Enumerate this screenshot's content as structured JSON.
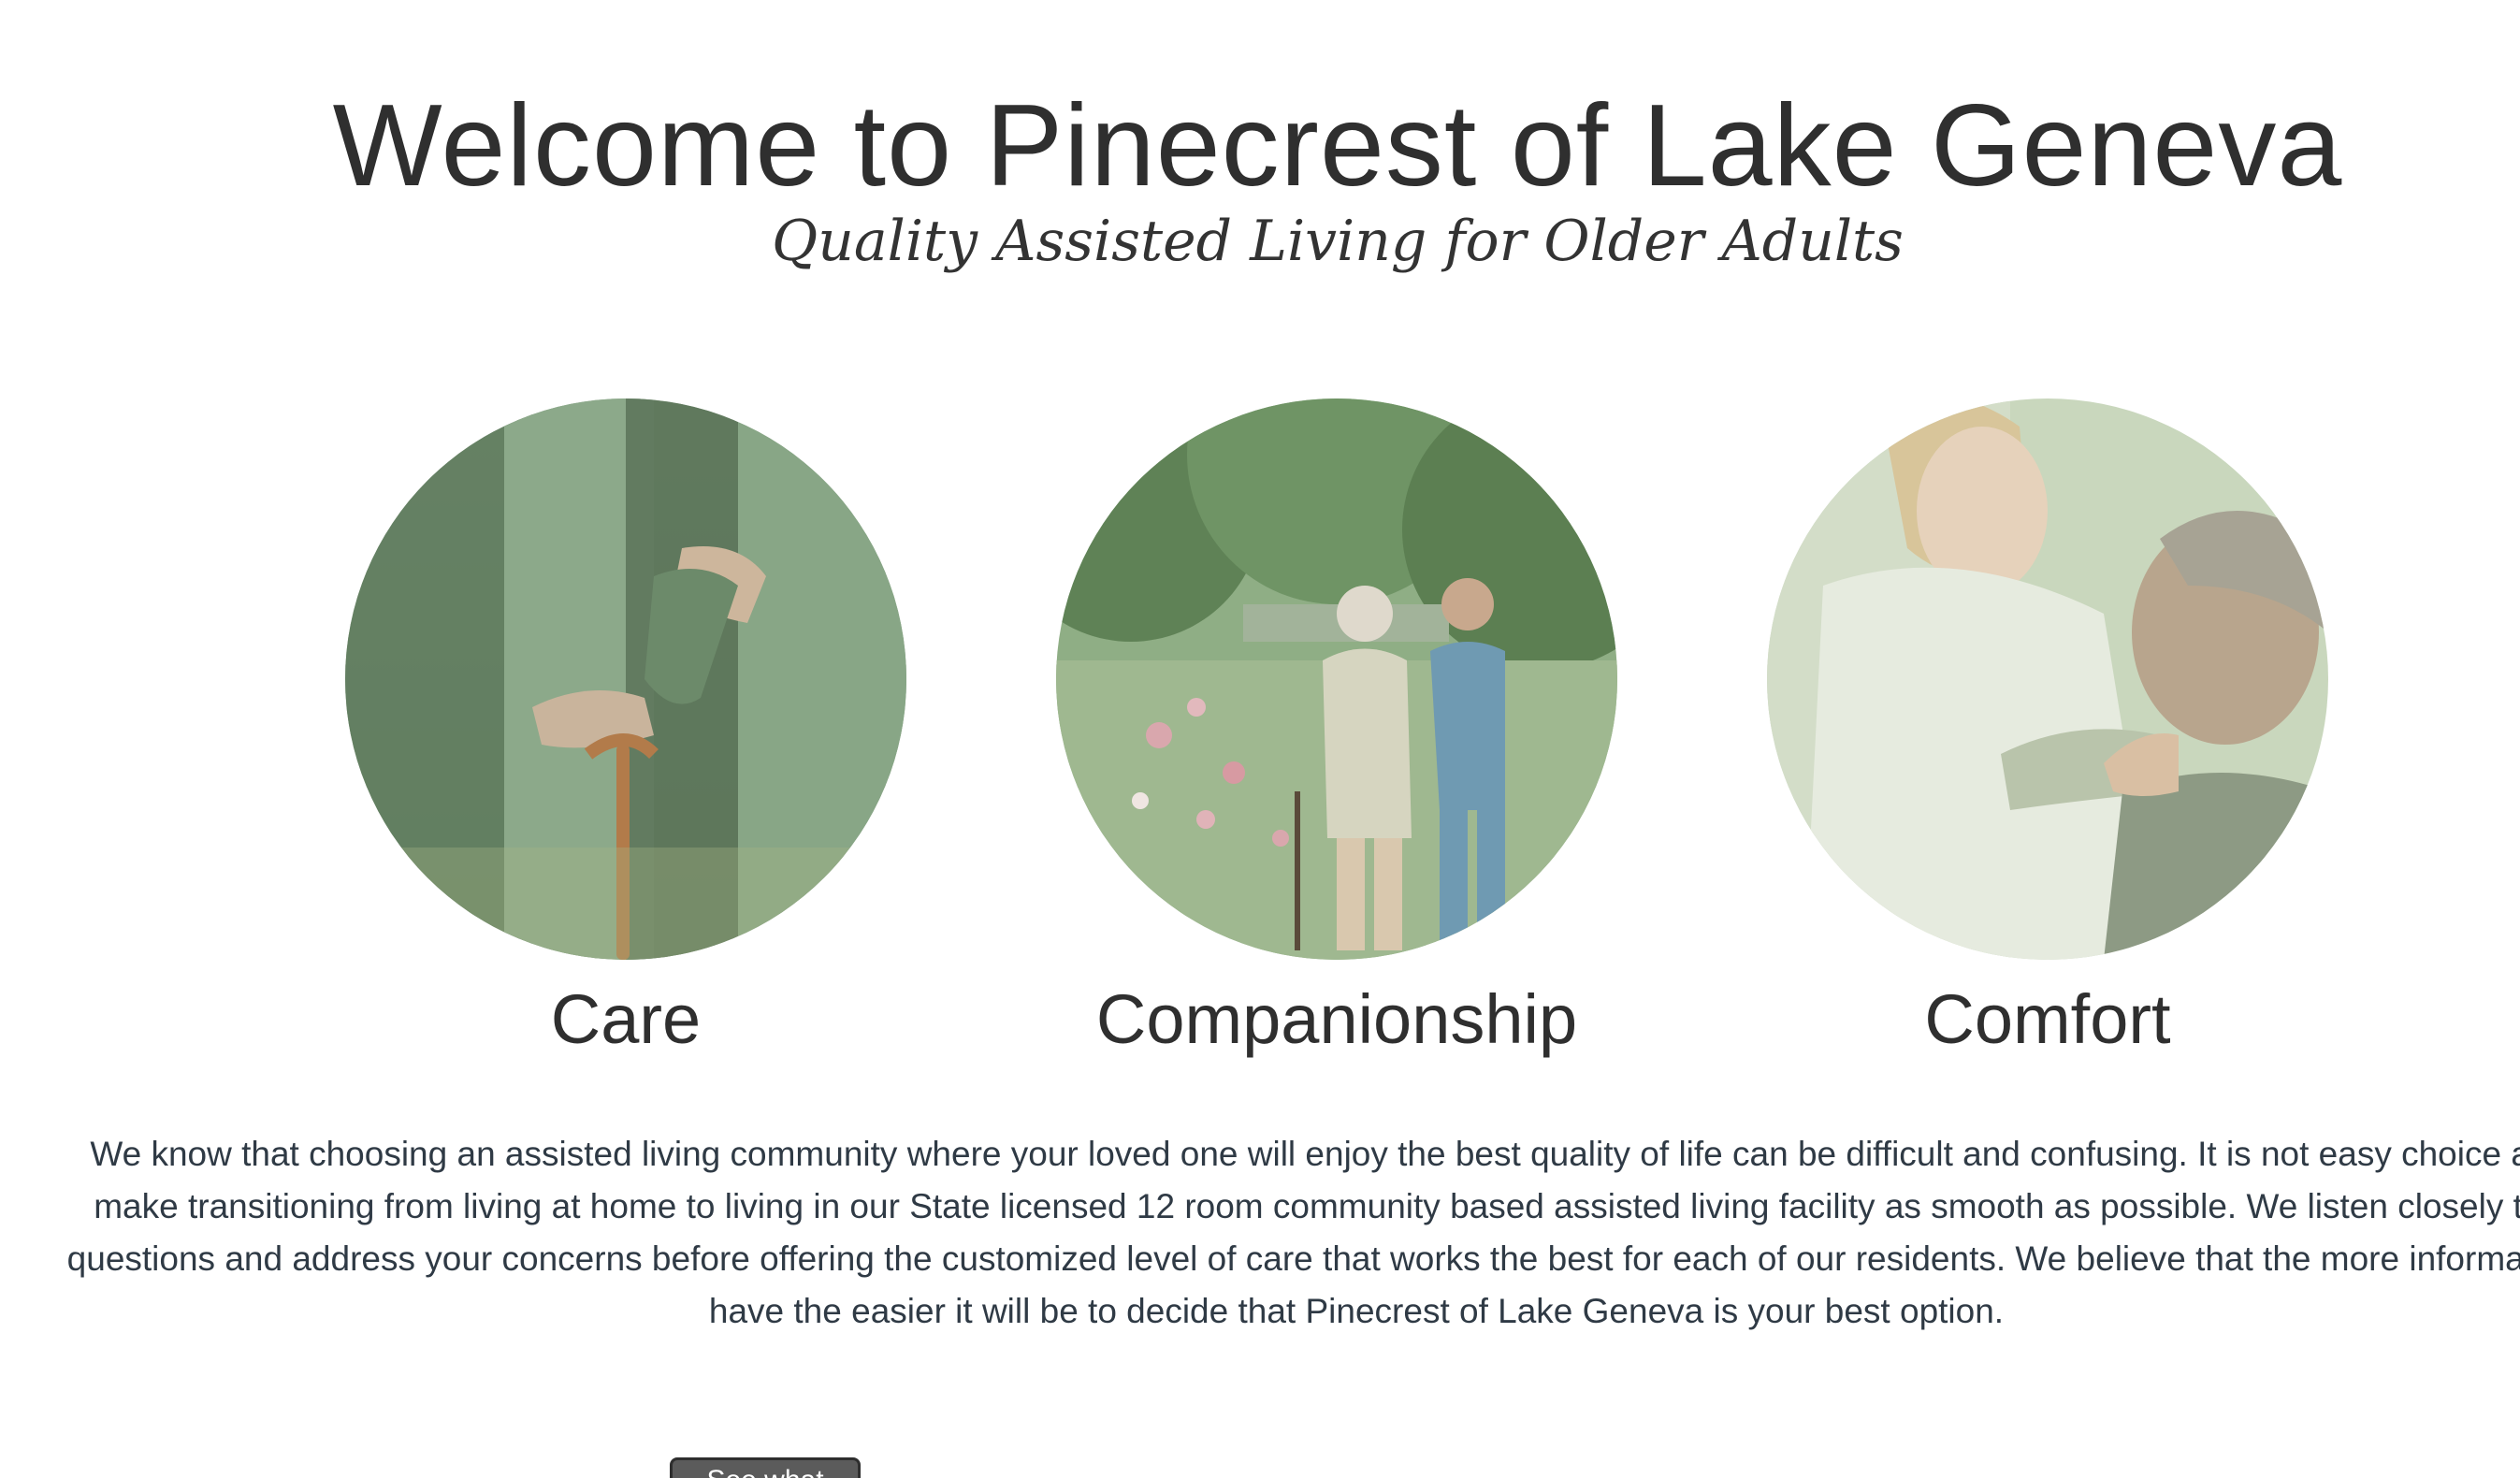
{
  "header": {
    "title": "Welcome to Pinecrest of Lake Geneva",
    "subtitle": "Quality Assisted Living for Older Adults"
  },
  "features": [
    {
      "label": "Care",
      "image": "elderly-hands-cane-photo"
    },
    {
      "label": "Companionship",
      "image": "caregiver-walking-with-senior-photo"
    },
    {
      "label": "Comfort",
      "image": "nurse-comforting-senior-photo"
    }
  ],
  "intro": {
    "text": "We know that choosing an assisted living community where your loved one will enjoy the best quality of life can be difficult and confusing. It is not easy choice and we make transitioning from living at home to living in our State licensed 12 room community based assisted living facility as smooth as possible. We listen closely to your questions and address your concerns before offering the customized level of care that works the best for each of our residents. We believe that the more information you have the easier it will be to decide that Pinecrest of Lake Geneva is your best option."
  },
  "cta": {
    "label": "See what"
  },
  "colors": {
    "tint": "#8fae85",
    "text": "#2f2f2f",
    "body_text": "#2f3a45",
    "button": "#5b5b5b"
  }
}
